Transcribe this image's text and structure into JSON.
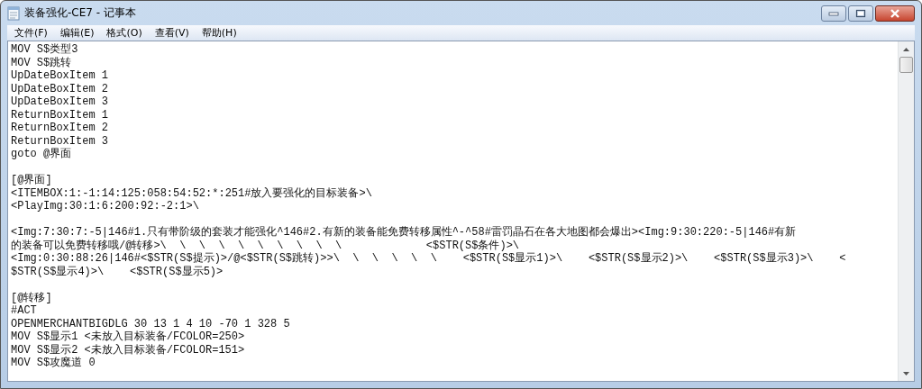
{
  "window": {
    "title": "装备强化-CE7 - 记事本"
  },
  "menu": [
    "文件(F)",
    "编辑(E)",
    "格式(O)",
    "查看(V)",
    "帮助(H)"
  ],
  "paragraphs": [
    {
      "lines": [
        "MOV S$类型3",
        "MOV S$跳转",
        "UpDateBoxItem 1",
        "UpDateBoxItem 2",
        "UpDateBoxItem 3",
        "ReturnBoxItem 1",
        "ReturnBoxItem 2",
        "ReturnBoxItem 3",
        "goto @界面"
      ]
    },
    {
      "lines": [
        "[@界面]",
        "<ITEMBOX:1:-1:14:125:058:54:52:*:251#放入要强化的目标装备>\\",
        "<PlayImg:30:1:6:200:92:-2:1>\\"
      ]
    },
    {
      "lines": [
        "<Img:7:30:7:-5|146#1.只有带阶级的套装才能强化^146#2.有新的装备能免费转移属性^-^58#雷罚晶石在各大地图都会爆出><Img:9:30:220:-5|146#有新",
        "的装备可以免费转移哦/@转移>\\  \\  \\  \\  \\  \\  \\  \\  \\  \\             <$STR(S$条件)>\\",
        "<Img:0:30:88:26|146#<$STR(S$提示)>/@<$STR(S$跳转)>>\\  \\  \\  \\  \\  \\    <$STR(S$显示1)>\\    <$STR(S$显示2)>\\    <$STR(S$显示3)>\\    <",
        "$STR(S$显示4)>\\    <$STR(S$显示5)>"
      ]
    },
    {
      "lines": [
        "[@转移]",
        "#ACT",
        "OPENMERCHANTBIGDLG 30 13 1 4 10 -70 1 328 5",
        "MOV S$显示1 <未放入目标装备/FCOLOR=250>",
        "MOV S$显示2 <未放入目标装备/FCOLOR=151>",
        "MOV S$攻魔道 0"
      ]
    }
  ]
}
